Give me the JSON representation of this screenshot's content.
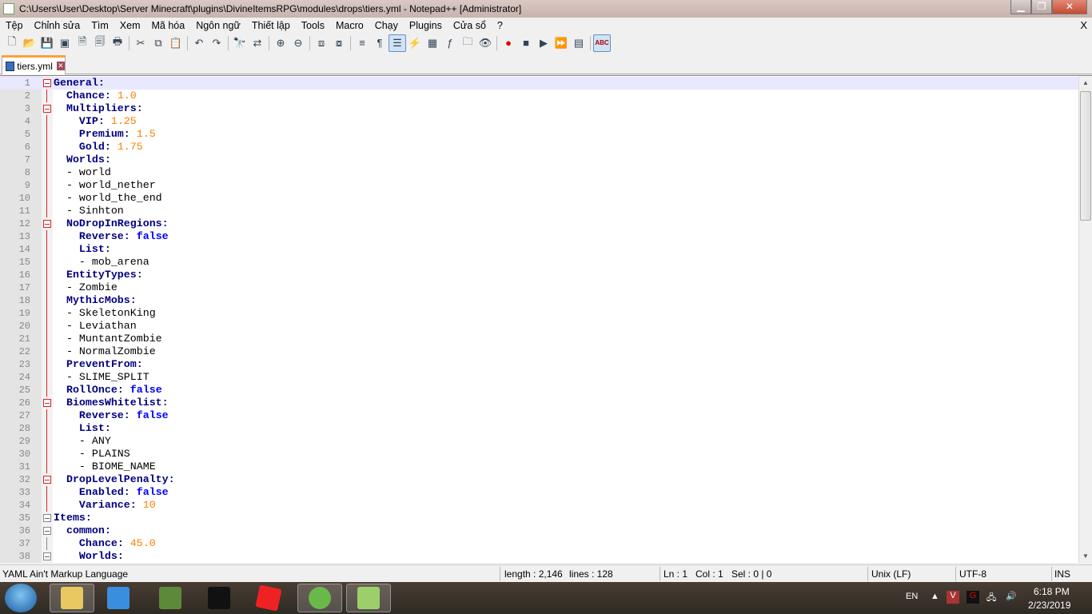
{
  "window": {
    "title": "C:\\Users\\User\\Desktop\\Server Minecraft\\plugins\\DivineItemsRPG\\modules\\drops\\tiers.yml - Notepad++ [Administrator]"
  },
  "menu": [
    "Tệp",
    "Chỉnh sửa",
    "Tìm",
    "Xem",
    "Mã hóa",
    "Ngôn ngữ",
    "Thiết lập",
    "Tools",
    "Macro",
    "Chạy",
    "Plugins",
    "Cửa sổ",
    "?"
  ],
  "menu_close": "X",
  "tab": {
    "label": "tiers.yml"
  },
  "lines": [
    {
      "n": "1",
      "i": 0,
      "k": "General",
      "fold": "r",
      "cur": true
    },
    {
      "n": "2",
      "i": 2,
      "k": "Chance",
      "v": "1.0",
      "t": "num"
    },
    {
      "n": "3",
      "i": 2,
      "k": "Multipliers",
      "fold": "r"
    },
    {
      "n": "4",
      "i": 4,
      "k": "VIP",
      "v": "1.25",
      "t": "num"
    },
    {
      "n": "5",
      "i": 4,
      "k": "Premium",
      "v": "1.5",
      "t": "num"
    },
    {
      "n": "6",
      "i": 4,
      "k": "Gold",
      "v": "1.75",
      "t": "num"
    },
    {
      "n": "7",
      "i": 2,
      "k": "Worlds"
    },
    {
      "n": "8",
      "i": 2,
      "p": "- world"
    },
    {
      "n": "9",
      "i": 2,
      "p": "- world_nether"
    },
    {
      "n": "10",
      "i": 2,
      "p": "- world_the_end"
    },
    {
      "n": "11",
      "i": 2,
      "p": "- Sinhton"
    },
    {
      "n": "12",
      "i": 2,
      "k": "NoDropInRegions",
      "fold": "r"
    },
    {
      "n": "13",
      "i": 4,
      "k": "Reverse",
      "v": "false",
      "t": "bool"
    },
    {
      "n": "14",
      "i": 4,
      "k": "List"
    },
    {
      "n": "15",
      "i": 4,
      "p": "- mob_arena"
    },
    {
      "n": "16",
      "i": 2,
      "k": "EntityTypes"
    },
    {
      "n": "17",
      "i": 2,
      "p": "- Zombie"
    },
    {
      "n": "18",
      "i": 2,
      "k": "MythicMobs"
    },
    {
      "n": "19",
      "i": 2,
      "p": "- SkeletonKing"
    },
    {
      "n": "20",
      "i": 2,
      "p": "- Leviathan"
    },
    {
      "n": "21",
      "i": 2,
      "p": "- MuntantZombie"
    },
    {
      "n": "22",
      "i": 2,
      "p": "- NormalZombie"
    },
    {
      "n": "23",
      "i": 2,
      "k": "PreventFrom"
    },
    {
      "n": "24",
      "i": 2,
      "p": "- SLIME_SPLIT"
    },
    {
      "n": "25",
      "i": 2,
      "k": "RollOnce",
      "v": "false",
      "t": "bool"
    },
    {
      "n": "26",
      "i": 2,
      "k": "BiomesWhitelist",
      "fold": "r"
    },
    {
      "n": "27",
      "i": 4,
      "k": "Reverse",
      "v": "false",
      "t": "bool"
    },
    {
      "n": "28",
      "i": 4,
      "k": "List"
    },
    {
      "n": "29",
      "i": 4,
      "p": "- ANY"
    },
    {
      "n": "30",
      "i": 4,
      "p": "- PLAINS"
    },
    {
      "n": "31",
      "i": 4,
      "p": "- BIOME_NAME"
    },
    {
      "n": "32",
      "i": 2,
      "k": "DropLevelPenalty",
      "fold": "r"
    },
    {
      "n": "33",
      "i": 4,
      "k": "Enabled",
      "v": "false",
      "t": "bool"
    },
    {
      "n": "34",
      "i": 4,
      "k": "Variance",
      "v": "10",
      "t": "num"
    },
    {
      "n": "35",
      "i": 0,
      "k": "Items",
      "fold": "g"
    },
    {
      "n": "36",
      "i": 2,
      "k": "common",
      "fold": "g"
    },
    {
      "n": "37",
      "i": 4,
      "k": "Chance",
      "v": "45.0",
      "t": "num"
    },
    {
      "n": "38",
      "i": 4,
      "k": "Worlds",
      "fold": "g"
    }
  ],
  "status": {
    "language": "YAML Ain't Markup Language",
    "length": "length : 2,146",
    "lines": "lines : 128",
    "ln": "Ln : 1",
    "col": "Col : 1",
    "sel": "Sel : 0 | 0",
    "eol": "Unix (LF)",
    "encoding": "UTF-8",
    "mode": "INS"
  },
  "tray": {
    "lang": "EN",
    "time": "6:18 PM",
    "date": "2/23/2019"
  }
}
